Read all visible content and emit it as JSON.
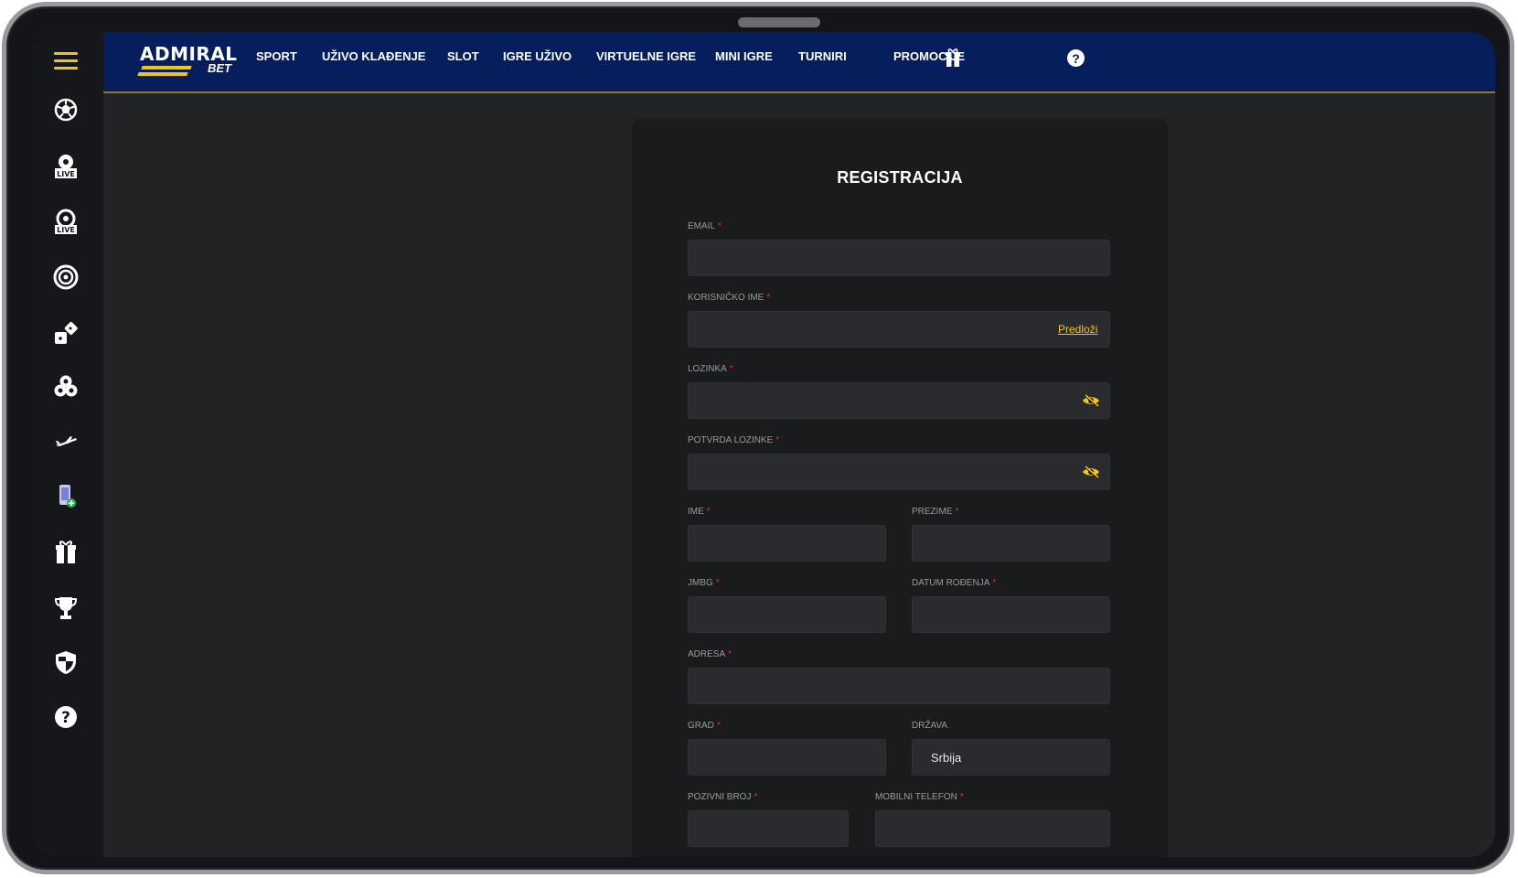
{
  "nav": {
    "items": [
      {
        "label": "SPORT"
      },
      {
        "label": "UŽIVO KLAĐENJE"
      },
      {
        "label": "SLOT"
      },
      {
        "label": "IGRE UŽIVO"
      },
      {
        "label": "VIRTUELNE IGRE"
      },
      {
        "label": "MINI IGRE"
      },
      {
        "label": "TURNIRI"
      },
      {
        "label": "PROMOCIJE"
      }
    ],
    "help": "?"
  },
  "logo": {
    "text": "ADMIRAL",
    "sub": "BET"
  },
  "sidebar": {
    "icons": [
      "football-icon",
      "live-sport-icon",
      "live-casino-icon",
      "roulette-icon",
      "dice-icon",
      "poker-chips-icon",
      "plane-icon",
      "mobile-icon",
      "gift-icon",
      "trophy-icon",
      "shield-icon",
      "help-icon"
    ]
  },
  "form": {
    "title": "REGISTRACIJA",
    "required_mark": "*",
    "labels": {
      "email": "EMAIL",
      "username": "KORISNIČKO IME",
      "password": "LOZINKA",
      "password_confirm": "POTVRDA LOZINKE",
      "first_name": "IME",
      "last_name": "PREZIME",
      "jmbg": "JMBG",
      "birth_date": "DATUM ROĐENJA",
      "address": "ADRESA",
      "city": "GRAD",
      "country": "DRŽAVA",
      "area_code": "POZIVNI BROJ",
      "mobile": "MOBILNI TELEFON"
    },
    "suggest_link": "Predloži",
    "country_value": "Srbija"
  },
  "colors": {
    "accent": "#f0c419",
    "nav_bg": "#061f5c",
    "required": "#e0303a"
  }
}
